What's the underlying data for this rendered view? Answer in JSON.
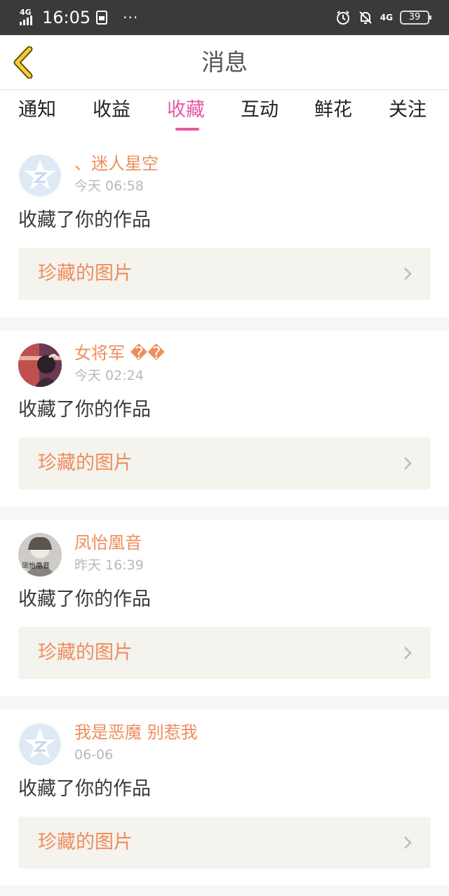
{
  "status_bar": {
    "network": "4G",
    "time": "16:05",
    "sim_icon": "sim-card-icon",
    "more": "···",
    "right_network": "4G",
    "battery": "39"
  },
  "header": {
    "title": "消息",
    "back_icon": "back-chevron-icon"
  },
  "tabs": [
    "通知",
    "收益",
    "收藏",
    "互动",
    "鲜花",
    "关注"
  ],
  "active_tab": "收藏",
  "feed": [
    {
      "username": "、迷人星空",
      "time": "今天 06:58",
      "action": "收藏了你的作品",
      "link": "珍藏的图片",
      "avatar": "default-avatar"
    },
    {
      "username": "女将军 ��",
      "time": "今天 02:24",
      "action": "收藏了你的作品",
      "link": "珍藏的图片",
      "avatar": "photo-avatar"
    },
    {
      "username": "凤怡凰音",
      "time": "昨天 16:39",
      "action": "收藏了你的作品",
      "link": "珍藏的图片",
      "avatar": "photo-avatar",
      "avatar_text": "凤怡凰音"
    },
    {
      "username": "我是恶魔 别惹我",
      "time": "06-06",
      "action": "收藏了你的作品",
      "link": "珍藏的图片",
      "avatar": "default-avatar"
    }
  ],
  "colors": {
    "accent": "#e25aa5",
    "username": "#ef8d5c",
    "link_bg": "#f4f3ee",
    "status_bar": "#3a3a3a"
  }
}
